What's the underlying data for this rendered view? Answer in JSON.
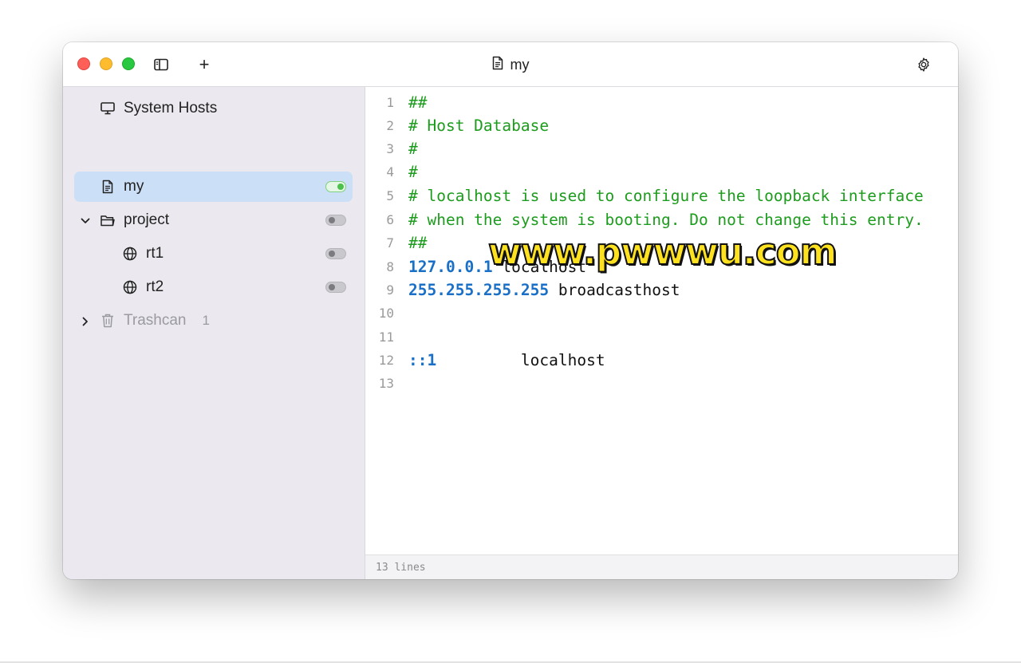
{
  "window": {
    "title": "my",
    "add_label": "+"
  },
  "sidebar": {
    "items": [
      {
        "label": "System Hosts",
        "icon": "monitor-icon"
      },
      {
        "label": "my",
        "icon": "file-icon",
        "enabled": true,
        "selected": true
      },
      {
        "label": "project",
        "icon": "folder-icon",
        "enabled": false,
        "expanded": true
      },
      {
        "label": "rt1",
        "icon": "globe-icon",
        "enabled": false
      },
      {
        "label": "rt2",
        "icon": "globe-icon",
        "enabled": false
      },
      {
        "label": "Trashcan",
        "icon": "trash-icon",
        "count": "1",
        "expanded": false
      }
    ]
  },
  "editor": {
    "lines": [
      {
        "n": "1",
        "text": "##",
        "kind": "comment"
      },
      {
        "n": "2",
        "text": "# Host Database",
        "kind": "comment"
      },
      {
        "n": "3",
        "text": "#",
        "kind": "comment"
      },
      {
        "n": "4",
        "text": "#",
        "kind": "comment"
      },
      {
        "n": "5",
        "text": "# localhost is used to configure the loopback interface",
        "kind": "comment"
      },
      {
        "n": "6",
        "text": "# when the system is booting. Do not change this entry.",
        "kind": "comment"
      },
      {
        "n": "7",
        "text": "##",
        "kind": "comment"
      },
      {
        "n": "8",
        "ip": "127.0.0.1",
        "host": " localhost",
        "kind": "entry"
      },
      {
        "n": "9",
        "ip": "255.255.255.255",
        "host": " broadcasthost",
        "kind": "entry"
      },
      {
        "n": "10",
        "text": "",
        "kind": "blank"
      },
      {
        "n": "11",
        "text": "",
        "kind": "blank"
      },
      {
        "n": "12",
        "ip": "::1",
        "host": "         localhost",
        "kind": "entry"
      },
      {
        "n": "13",
        "text": "",
        "kind": "blank"
      }
    ]
  },
  "status": {
    "lines_label": "13 lines"
  },
  "watermark": "www.pwwwu.com",
  "colors": {
    "comment": "#1c9c1c",
    "ip": "#1a6fc7",
    "selection": "#cbdff6",
    "sidebar_bg": "#ebe9ef",
    "toggle_on": "#4cc14c"
  }
}
